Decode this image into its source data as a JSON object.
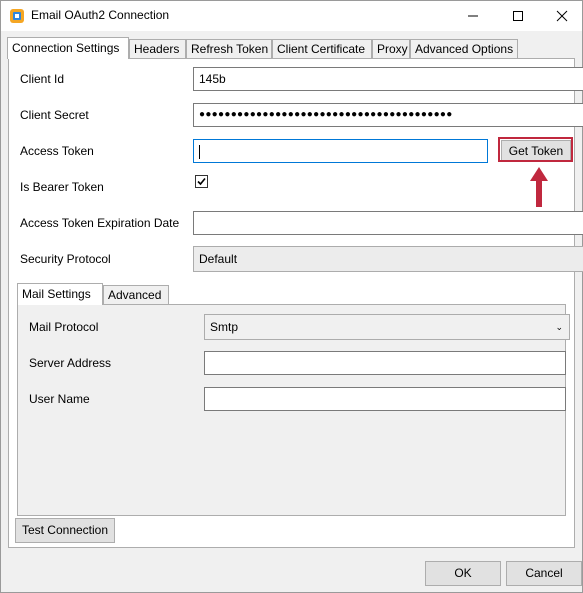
{
  "window": {
    "title": "Email OAuth2 Connection"
  },
  "tabs": [
    "Connection Settings",
    "Headers",
    "Refresh Token",
    "Client Certificate",
    "Proxy",
    "Advanced Options"
  ],
  "fields": {
    "client_id": {
      "label": "Client Id",
      "value": "145b"
    },
    "client_secret": {
      "label": "Client Secret",
      "value": "●●●●●●●●●●●●●●●●●●●●●●●●●●●●●●●●●●●●●●●●"
    },
    "access_token": {
      "label": "Access Token",
      "value": ""
    },
    "is_bearer_token": {
      "label": "Is Bearer Token",
      "checked": true
    },
    "expiration": {
      "label": "Access Token Expiration Date",
      "value": ""
    },
    "security_protocol": {
      "label": "Security Protocol",
      "value": "Default"
    }
  },
  "get_token_label": "Get Token",
  "inner_tabs": [
    "Mail Settings",
    "Advanced"
  ],
  "mail": {
    "protocol": {
      "label": "Mail Protocol",
      "value": "Smtp"
    },
    "server": {
      "label": "Server Address",
      "value": ""
    },
    "user": {
      "label": "User Name",
      "value": ""
    }
  },
  "buttons": {
    "test": "Test Connection",
    "ok": "OK",
    "cancel": "Cancel"
  },
  "colors": {
    "highlight": "#c0283e",
    "focus": "#0078d7"
  }
}
